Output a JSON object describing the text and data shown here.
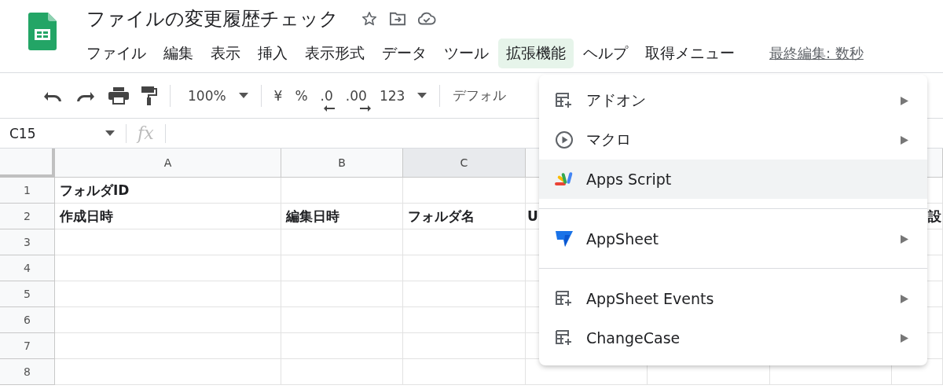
{
  "title": "ファイルの変更履歴チェック",
  "menubar": [
    {
      "label": "ファイル",
      "selected": false
    },
    {
      "label": "編集",
      "selected": false
    },
    {
      "label": "表示",
      "selected": false
    },
    {
      "label": "挿入",
      "selected": false
    },
    {
      "label": "表示形式",
      "selected": false
    },
    {
      "label": "データ",
      "selected": false
    },
    {
      "label": "ツール",
      "selected": false
    },
    {
      "label": "拡張機能",
      "selected": true
    },
    {
      "label": "ヘルプ",
      "selected": false
    },
    {
      "label": "取得メニュー",
      "selected": false
    }
  ],
  "last_edit": "最終編集: 数秒",
  "toolbar": {
    "zoom": "100%",
    "currency": "¥",
    "percent": "%",
    "decrease_decimals": ".0",
    "increase_decimals": ".00",
    "number_format": "123",
    "font": "デフォル"
  },
  "name_box": "C15",
  "formula_label": "fx",
  "columns": [
    {
      "label": "A",
      "selected": false
    },
    {
      "label": "B",
      "selected": false
    },
    {
      "label": "C",
      "selected": true
    }
  ],
  "rows": [
    {
      "number": "1",
      "cells": [
        {
          "text": "フォルダID"
        }
      ]
    },
    {
      "number": "2",
      "cells": [
        {
          "text": "作成日時"
        },
        {
          "text": "編集日時"
        },
        {
          "text": "フォルダ名"
        },
        {
          "text": "U"
        },
        {},
        {},
        {
          "text": "設"
        }
      ]
    },
    {
      "number": "3"
    },
    {
      "number": "4"
    },
    {
      "number": "5"
    },
    {
      "number": "6"
    },
    {
      "number": "7"
    },
    {
      "number": "8"
    }
  ],
  "dropdown": [
    {
      "kind": "addon",
      "label": "アドオン",
      "submenu": true,
      "selected": false
    },
    {
      "kind": "macro",
      "label": "マクロ",
      "submenu": true,
      "selected": false
    },
    {
      "kind": "script",
      "label": "Apps Script",
      "submenu": false,
      "selected": true
    },
    {
      "kind": "separator"
    },
    {
      "kind": "appsheet",
      "label": "AppSheet",
      "submenu": true,
      "selected": false
    },
    {
      "kind": "separator"
    },
    {
      "kind": "addon",
      "label": "AppSheet Events",
      "submenu": true,
      "selected": false
    },
    {
      "kind": "addon",
      "label": "ChangeCase",
      "submenu": true,
      "selected": false
    }
  ]
}
